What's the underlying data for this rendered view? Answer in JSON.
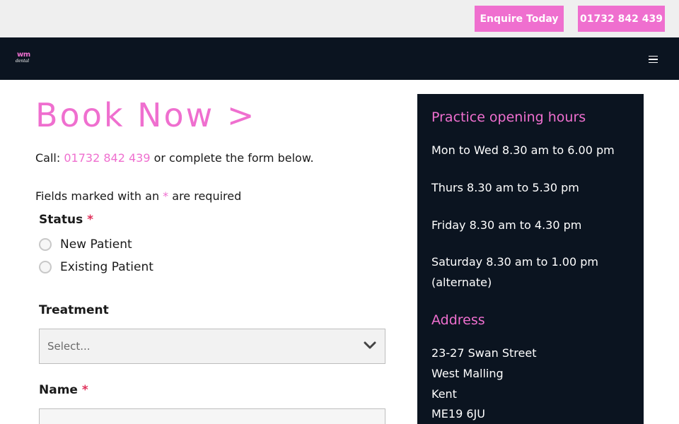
{
  "topbar": {
    "enquire_label": "Enquire Today",
    "phone_label": "01732 842 439"
  },
  "navbar": {
    "logo_mark": "wm",
    "logo_sub": "dental"
  },
  "main": {
    "title": "Book Now >",
    "call_prefix": "Call: ",
    "call_phone": "01732 842 439",
    "call_suffix": " or complete the form below.",
    "fields_note_prefix": "Fields marked with an ",
    "fields_note_star": "*",
    "fields_note_suffix": " are required",
    "status_label": "Status",
    "required_star": "*",
    "status_options": [
      "New Patient",
      "Existing Patient"
    ],
    "treatment_label": "Treatment",
    "treatment_value": "Select...",
    "name_label": "Name"
  },
  "sidebar": {
    "hours_heading": "Practice opening hours",
    "hours": [
      "Mon to Wed 8.30 am to 6.00 pm",
      "Thurs 8.30 am to 5.30 pm",
      "Friday 8.30 am to 4.30 pm",
      "Saturday 8.30 am to 1.00 pm",
      "(alternate)"
    ],
    "address_heading": "Address",
    "address": [
      "23-27 Swan Street",
      "West Malling",
      "Kent",
      "ME19 6JU"
    ]
  },
  "colors": {
    "accent": "#ef6fcf",
    "dark": "#0b1420",
    "required": "#e0305a"
  }
}
